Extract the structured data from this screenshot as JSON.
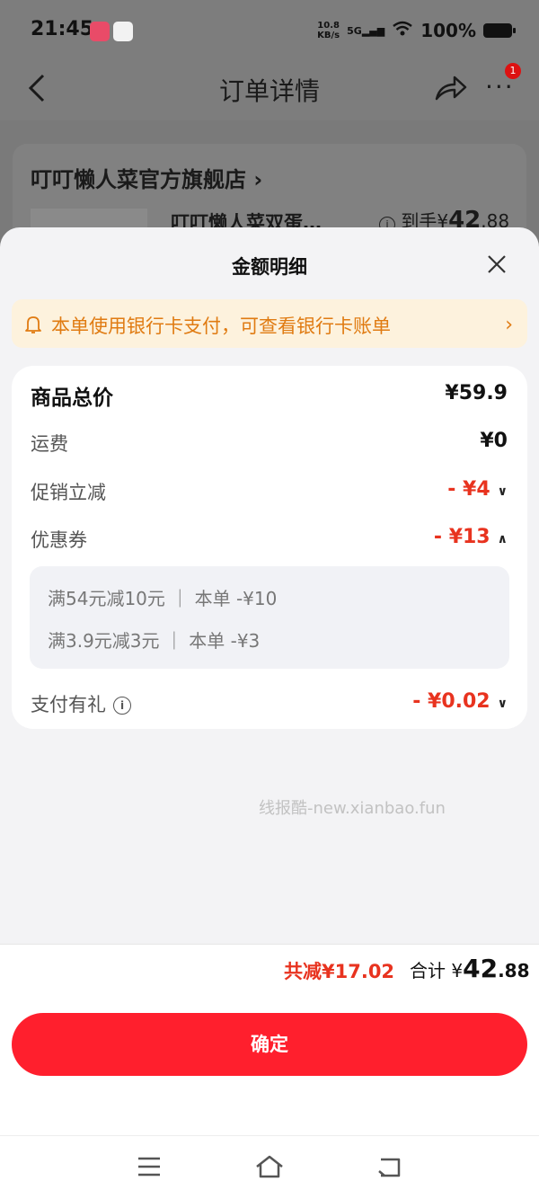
{
  "status_bar": {
    "time": "21:45",
    "net_speed_value": "10.8",
    "net_speed_unit": "KB/s",
    "signal_label": "5G",
    "battery": "100%"
  },
  "nav": {
    "title": "订单详情",
    "badge_count": "1"
  },
  "background_order": {
    "shop_name": "叮叮懒人菜官方旗舰店 ›",
    "product_name": "叮叮懒人菜双蛋…",
    "price_prefix": "到手¥",
    "price_int": "42",
    "price_dec": ".88"
  },
  "sheet": {
    "title": "金额明细",
    "notice": "本单使用银行卡支付，可查看银行卡账单",
    "rows": {
      "total_label": "商品总价",
      "total_value": "¥59.9",
      "shipping_label": "运费",
      "shipping_value": "¥0",
      "promo_label": "促销立减",
      "promo_value": "- ¥4",
      "coupon_label": "优惠券",
      "coupon_value": "- ¥13",
      "pay_gift_label": "支付有礼",
      "pay_gift_value": "- ¥0.02"
    },
    "coupons": [
      "满54元减10元 ｜ 本单 -¥10",
      "满3.9元减3元 ｜ 本单 -¥3"
    ],
    "watermark": "线报酷-new.xianbao.fun"
  },
  "summary": {
    "saved": "共减¥17.02",
    "total_label": "合计 ¥",
    "total_int": "42",
    "total_dec": ".88"
  },
  "footer": {
    "confirm_label": "确定"
  },
  "colors": {
    "accent_red": "#ff1f2d",
    "discount_red": "#e8331f",
    "notice_bg": "#fdf2dd",
    "notice_text": "#e07b12"
  }
}
